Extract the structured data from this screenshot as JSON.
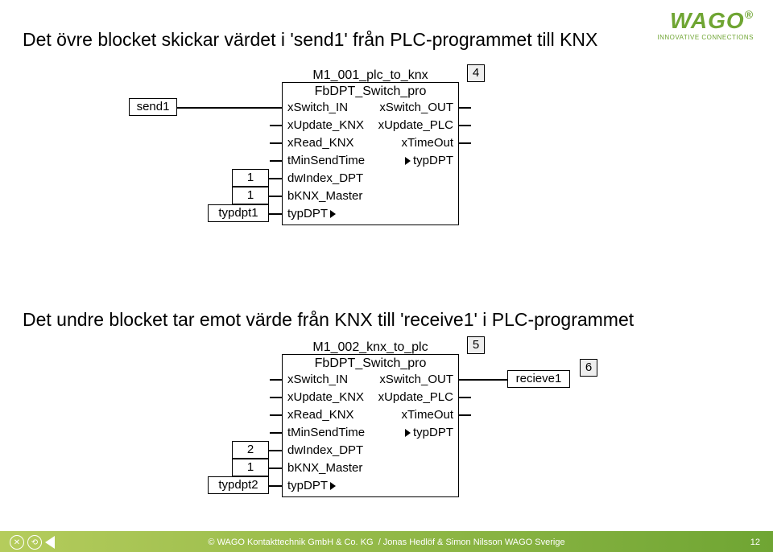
{
  "brand": {
    "name": "WAGO",
    "reg": "®",
    "tagline": "INNOVATIVE CONNECTIONS"
  },
  "heading_top": "Det övre blocket skickar värdet i 'send1' från PLC-programmet till KNX",
  "heading_bottom": "Det undre blocket tar emot värde från KNX till 'receive1' i PLC-programmet",
  "block1": {
    "name": "M1_001_plc_to_knx",
    "type": "FbDPT_Switch_pro",
    "id": "4",
    "inputs": [
      "xSwitch_IN",
      "xUpdate_KNX",
      "xRead_KNX",
      "tMinSendTime",
      "dwIndex_DPT",
      "bKNX_Master",
      "typDPT"
    ],
    "outputs": [
      "xSwitch_OUT",
      "xUpdate_PLC",
      "xTimeOut",
      "typDPT"
    ],
    "left_vars": {
      "send1": "send1",
      "idx": "1",
      "master": "1",
      "typ": "typdpt1"
    }
  },
  "block2": {
    "name": "M1_002_knx_to_plc",
    "type": "FbDPT_Switch_pro",
    "id": "5",
    "out_id": "6",
    "inputs": [
      "xSwitch_IN",
      "xUpdate_KNX",
      "xRead_KNX",
      "tMinSendTime",
      "dwIndex_DPT",
      "bKNX_Master",
      "typDPT"
    ],
    "outputs": [
      "xSwitch_OUT",
      "xUpdate_PLC",
      "xTimeOut",
      "typDPT"
    ],
    "left_vars": {
      "idx": "2",
      "master": "1",
      "typ": "typdpt2"
    },
    "right_var": "recieve1"
  },
  "footer": {
    "copyright": "© WAGO Kontakttechnik GmbH & Co. KG",
    "author": "/ Jonas Hedlöf & Simon Nilsson WAGO Sverige",
    "page": "12"
  }
}
